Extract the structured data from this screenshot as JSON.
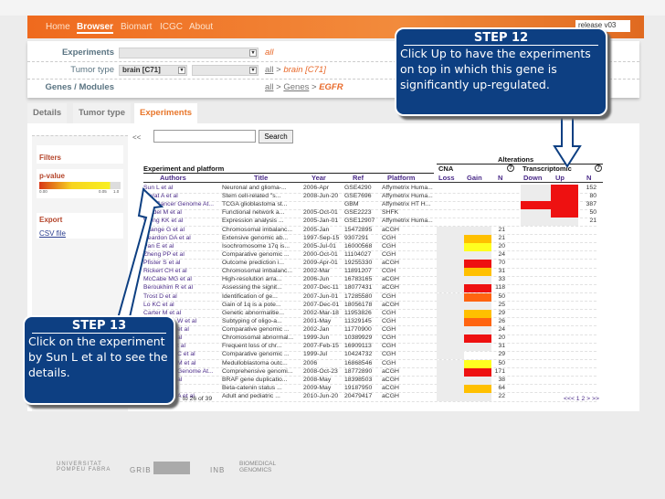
{
  "nav": {
    "items": [
      "Home",
      "Browser",
      "Biomart",
      "ICGC",
      "About"
    ],
    "active": "Browser",
    "release": "release v03"
  },
  "filters": {
    "experiments": {
      "label": "Experiments",
      "crumb": "all"
    },
    "tumor": {
      "label": "Tumor type",
      "select1": "brain [C71]",
      "crumb_all": "all",
      "sep": ">",
      "crumb_cur": "brain [C71]"
    },
    "genes": {
      "label": "Genes / Modules",
      "crumb_all": "all",
      "sep": ">",
      "crumb_mid": "Genes",
      "crumb_cur": "EGFR"
    }
  },
  "tabs": [
    "Details",
    "Tumor type",
    "Experiments"
  ],
  "sidebar": {
    "filters": "Filters",
    "pvalue": "p-value",
    "scale": [
      "0.00",
      "0.05",
      "1.0"
    ],
    "export": "Export",
    "csv": "CSV file"
  },
  "toolbar": {
    "collapse": "<<",
    "search_button": "Search"
  },
  "table": {
    "group": "Experiment and platform",
    "alterations": "Alterations",
    "cna": "CNA",
    "transcriptomic": "Transcriptomic",
    "help": "?",
    "columns": [
      "Authors",
      "Title",
      "Year",
      "Ref",
      "Platform",
      "Loss",
      "Gain",
      "N",
      "Down",
      "Up",
      "N"
    ],
    "rows": [
      {
        "author": "Sun L et al",
        "title": "Neuronal and glioma-...",
        "year": "2006-Apr",
        "ref": "GSE4290",
        "platform": "Affymetrix Huma...",
        "down": "gray",
        "up": "red",
        "tn": "152"
      },
      {
        "author": "Murat A et al",
        "title": "Stem cell-related \"s...",
        "year": "2008-Jun-20",
        "ref": "GSE7696",
        "platform": "Affymetrix Huma...",
        "down": "gray",
        "up": "red",
        "tn": "80"
      },
      {
        "author": "The Cancer Genome At...",
        "title": "TCGA glioblastoma st...",
        "year": "",
        "ref": "GBM",
        "platform": "Affymetrix HT H...",
        "down": "red",
        "up": "red",
        "tn": "387"
      },
      {
        "author": "Bredel M et al",
        "title": "Functional network a...",
        "year": "2005-Oct-01",
        "ref": "GSE2223",
        "platform": "SHFK",
        "down": "gray",
        "up": "red",
        "tn": "50"
      },
      {
        "author": "Wong KK et al",
        "title": "Expression analysis ...",
        "year": "2005-Jan-01",
        "ref": "GSE12907",
        "platform": "Affymetrix Huma...",
        "down": "gray",
        "up": "gray",
        "tn": "21"
      },
      {
        "author": "Kitange G et al",
        "title": "Chromosomal imbalanc...",
        "year": "2005-Jan",
        "ref": "15472895",
        "platform": "aCGH",
        "gain": "gray",
        "n": "21"
      },
      {
        "author": "Reardon DA et al",
        "title": "Extensive genomic ab...",
        "year": "1997-Sep-15",
        "ref": "9307291",
        "platform": "CGH",
        "gain": "orange",
        "n": "21"
      },
      {
        "author": "Pan E et al",
        "title": "Isochromosome 17q is...",
        "year": "2005-Jul-01",
        "ref": "16000568",
        "platform": "CGH",
        "gain": "yellow",
        "n": "20"
      },
      {
        "author": "Zheng PP et al",
        "title": "Comparative genomic ...",
        "year": "2000-Oct-01",
        "ref": "11104027",
        "platform": "CGH",
        "gain": "gray",
        "n": "24"
      },
      {
        "author": "Pfister S et al",
        "title": "Outcome prediction i...",
        "year": "2009-Apr-01",
        "ref": "19255330",
        "platform": "aCGH",
        "gain": "red",
        "n": "70"
      },
      {
        "author": "Rickert CH et al",
        "title": "Chromosomal imbalanc...",
        "year": "2002-Mar",
        "ref": "11891207",
        "platform": "CGH",
        "gain": "orange",
        "n": "31"
      },
      {
        "author": "McCabe MG et al",
        "title": "High-resolution arra...",
        "year": "2006-Jun",
        "ref": "16783165",
        "platform": "aCGH",
        "gain": "gray",
        "n": "33"
      },
      {
        "author": "Beroukhim R et al",
        "title": "Assessing the signit...",
        "year": "2007-Dec-11",
        "ref": "18077431",
        "platform": "aCGH",
        "gain": "red",
        "n": "118"
      },
      {
        "author": "Trost D et al",
        "title": "Identification of ge...",
        "year": "2007-Jun-01",
        "ref": "17285580",
        "platform": "CGH",
        "gain": "darkorange",
        "n": "50"
      },
      {
        "author": "Lo KC et al",
        "title": "Gain of 1q is a pote...",
        "year": "2007-Dec-01",
        "ref": "18056178",
        "platform": "aCGH",
        "gain": "gray",
        "n": "25"
      },
      {
        "author": "Carter M et al",
        "title": "Genetic abnormalitie...",
        "year": "2002-Mar-18",
        "ref": "11953826",
        "platform": "CGH",
        "gain": "orange",
        "n": "29"
      },
      {
        "author": "W et al",
        "hidden": true,
        "title": "Subtyping of oligo-a...",
        "year": "2001-May",
        "ref": "11329145",
        "platform": "CGH",
        "gain": "darkorange",
        "n": "26"
      },
      {
        "author": "et al",
        "hidden": true,
        "title": "Comparative genomic ...",
        "year": "2002-Jan",
        "ref": "11770900",
        "platform": "CGH",
        "gain": "gray",
        "n": "24"
      },
      {
        "author": "al",
        "hidden": true,
        "title": "Chromosomal abnormal...",
        "year": "1999-Jun",
        "ref": "10389929",
        "platform": "CGH",
        "gain": "red",
        "n": "20"
      },
      {
        "author": "t al",
        "hidden": true,
        "title": "Frequent loss of chr...",
        "year": "2007-Feb-15",
        "ref": "16909113",
        "platform": "CGH",
        "gain": "gray",
        "n": "31"
      },
      {
        "author": "C et al",
        "hidden": true,
        "title": "Comparative genomic ...",
        "year": "1999-Jul",
        "ref": "10424732",
        "platform": "CGH",
        "gain": "none",
        "n": "29"
      },
      {
        "author": "M et al",
        "hidden": true,
        "title": "Medulloblastoma outc...",
        "year": "2006",
        "ref": "16868546",
        "platform": "CGH",
        "gain": "yellow",
        "n": "50"
      },
      {
        "author": "Genome At...",
        "hidden": true,
        "title": "Comprehensive genomi...",
        "year": "2008-Oct-23",
        "ref": "18772890",
        "platform": "aCGH",
        "gain": "red",
        "n": "171"
      },
      {
        "author": "al",
        "hidden": true,
        "title": "BRAF gene duplicatio...",
        "year": "2008-May",
        "ref": "18398503",
        "platform": "aCGH",
        "gain": "gray",
        "n": "38"
      },
      {
        "author": "l",
        "hidden": true,
        "title": "Beta-catenin status ...",
        "year": "2009-May",
        "ref": "19187950",
        "platform": "aCGH",
        "gain": "orange",
        "n": "64"
      },
      {
        "author": "A et al",
        "hidden": true,
        "title": "Adult and pediatric ...",
        "year": "2010-Jun-20",
        "ref": "20479417",
        "platform": "aCGH",
        "gain": "gray",
        "n": "22"
      }
    ],
    "summary": "to 26 of 39",
    "pagination": "<<< 1 2 > >>"
  },
  "colors": {
    "red": "#ee1111",
    "orange": "#ffc000",
    "yellow": "#ffff20",
    "darkorange": "#ff6410",
    "gray": "#ececec",
    "none": "transparent",
    "step_bg": "#0d3f82",
    "nav": "#ef6a1e"
  },
  "steps": {
    "s12": {
      "title": "STEP 12",
      "body": "Click Up to have the experiments on top in which this gene is significantly up-regulated."
    },
    "s13": {
      "title": "STEP 13",
      "body": "Click on the experiment by Sun L et al to see the details."
    }
  },
  "footer": {
    "logos": [
      "UNIVERSITAT POMPEU FABRA",
      "GRIB",
      "INB",
      "BIOMEDICAL GENOMICS"
    ]
  }
}
